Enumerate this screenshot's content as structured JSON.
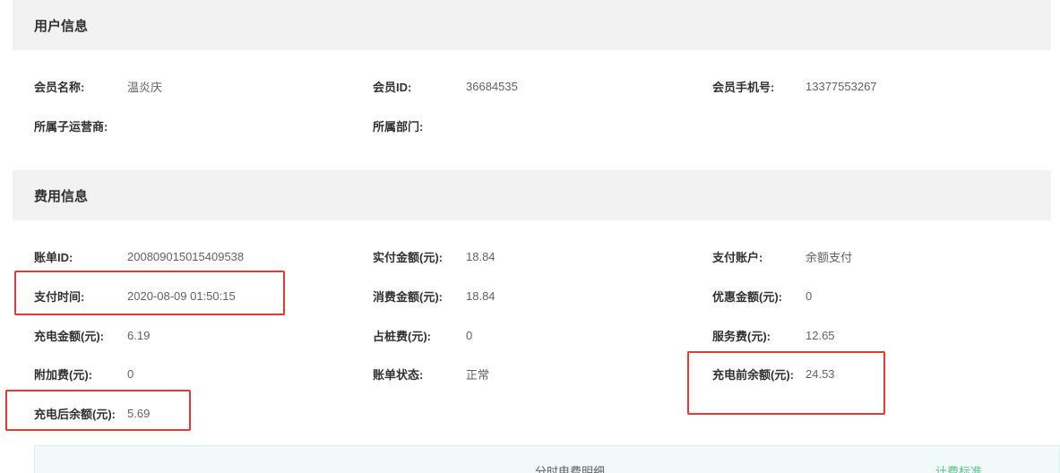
{
  "user_info": {
    "title": "用户信息",
    "fields": {
      "member_name": {
        "label": "会员名称:",
        "value": "温炎庆"
      },
      "member_id": {
        "label": "会员ID:",
        "value": "36684535"
      },
      "member_phone": {
        "label": "会员手机号:",
        "value": "13377553267"
      },
      "sub_operator": {
        "label": "所属子运营商:",
        "value": ""
      },
      "department": {
        "label": "所属部门:",
        "value": ""
      }
    }
  },
  "fee_info": {
    "title": "费用信息",
    "fields": {
      "bill_id": {
        "label": "账单ID:",
        "value": "200809015015409538"
      },
      "paid_amount": {
        "label": "实付金额(元):",
        "value": "18.84"
      },
      "pay_account": {
        "label": "支付账户:",
        "value": "余额支付"
      },
      "pay_time": {
        "label": "支付时间:",
        "value": "2020-08-09 01:50:15"
      },
      "consume_amount": {
        "label": "消费金额(元):",
        "value": "18.84"
      },
      "discount_amount": {
        "label": "优惠金额(元):",
        "value": "0"
      },
      "charge_amount": {
        "label": "充电金额(元):",
        "value": "6.19"
      },
      "occupy_fee": {
        "label": "占桩费(元):",
        "value": "0"
      },
      "service_fee": {
        "label": "服务费(元):",
        "value": "12.65"
      },
      "extra_fee": {
        "label": "附加费(元):",
        "value": "0"
      },
      "bill_status": {
        "label": "账单状态:",
        "value": "正常"
      },
      "balance_before": {
        "label": "充电前余额(元):",
        "value": "24.53"
      },
      "balance_after": {
        "label": "充电后余额(元):",
        "value": "5.69"
      }
    }
  },
  "detail": {
    "title": "分时电费明细",
    "link": "计费标准"
  },
  "colors": {
    "highlight": "#e53935",
    "link": "#5cc38f",
    "header_bg": "#f2f2f2"
  }
}
